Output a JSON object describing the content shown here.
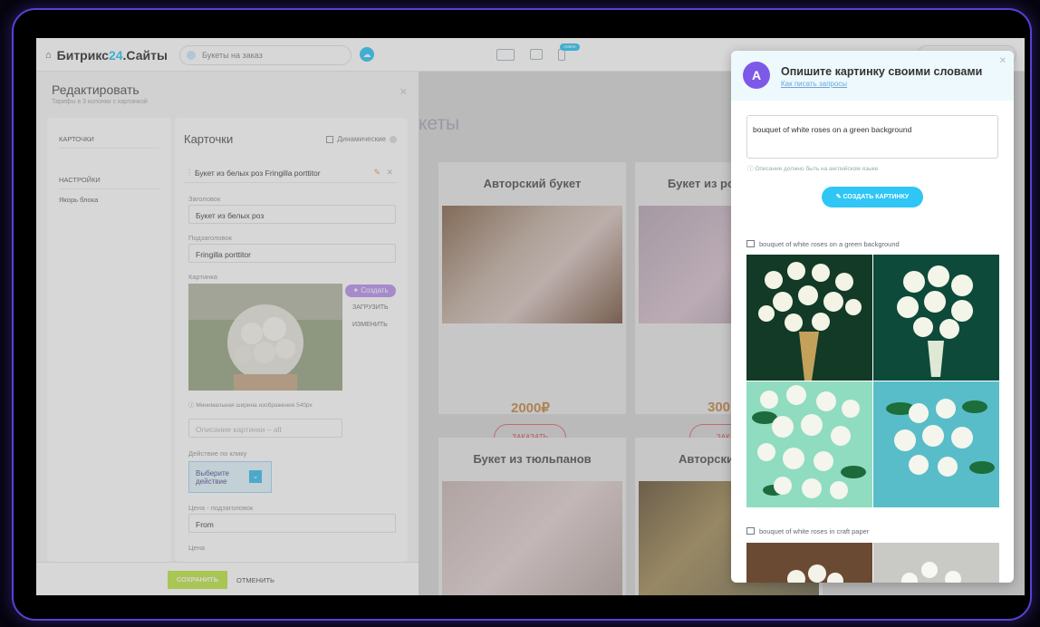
{
  "topbar": {
    "brand_prefix": "Битрикс",
    "brand_num": "24",
    "brand_suffix": ".Сайты",
    "url": "Букеты на заказ",
    "badge": "новое"
  },
  "background": {
    "heading": "кеты",
    "cards": [
      {
        "title": "Авторский букет",
        "price": "2000₽",
        "order": "ЗАКАЗАТЬ"
      },
      {
        "title": "Букет из ро",
        "price": "300",
        "order": "ЗАКА"
      },
      {
        "title": "Букет из тюльпанов"
      },
      {
        "title": "Авторски"
      }
    ]
  },
  "editor": {
    "title": "Редактировать",
    "subtitle": "Тарифы в 3 колонки с картинкой",
    "nav": {
      "cards": "КАРТОЧКИ",
      "settings": "НАСТРОЙКИ",
      "anchor": "Якорь блока"
    },
    "form": {
      "heading": "Карточки",
      "dynamic": "Динамические",
      "item": "Букет из белых роз Fringilla porttitor",
      "title_label": "Заголовок",
      "title_value": "Букет из белых роз",
      "subtitle_label": "Подзаголовок",
      "subtitle_value": "Fringilla porttitor",
      "picture_label": "Картинка",
      "create": "Создать",
      "upload": "ЗАГРУЗИТЬ",
      "change": "ИЗМЕНИТЬ",
      "note": "Минимальная ширина изображения 540px",
      "alt_placeholder": "Описание картинки – alt",
      "action_label": "Действие по клику",
      "action_value": "Выберите действие",
      "price_sub_label": "Цена - подзаголовок",
      "price_sub_value": "From",
      "price_label": "Цена"
    },
    "footer": {
      "save": "СОХРАНИТЬ",
      "cancel": "ОТМЕНИТЬ"
    }
  },
  "ai": {
    "title": "Опишите картинку своими словами",
    "link": "Как писать запросы",
    "prompt": "bouquet of white roses on a green background",
    "hint": "Описание должно быть на английском языке",
    "button": "СОЗДАТЬ КАРТИНКУ",
    "group1": "bouquet of white roses on a green background",
    "group2": "bouquet of white roses in craft paper"
  },
  "colors": {
    "accent": "#2fc6f6",
    "ai": "#7d59e8",
    "save": "#bfe64a"
  }
}
